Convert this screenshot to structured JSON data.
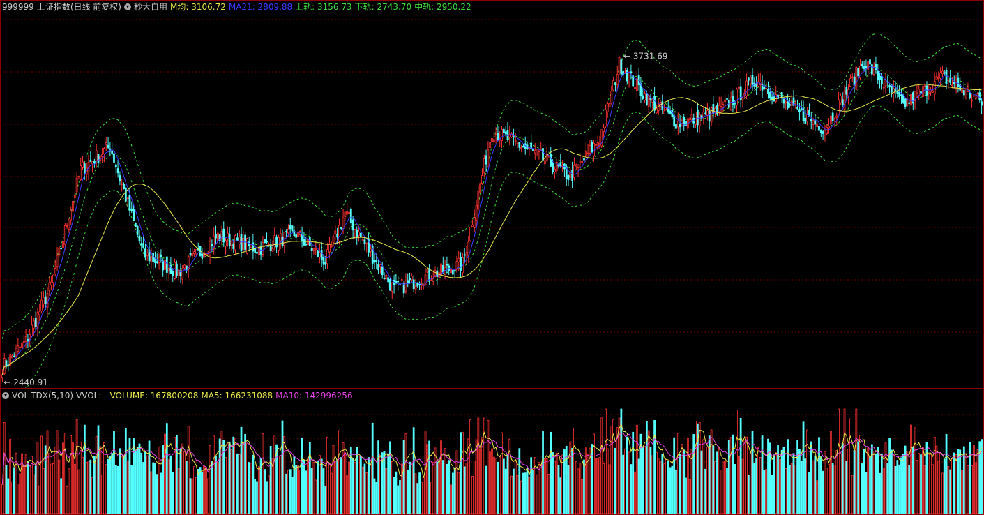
{
  "main_header": {
    "code": "999999",
    "name": "上证指数(日线 前复权)",
    "plugin": "秒大自用",
    "items": [
      {
        "label": "M均:",
        "value": "3106.72",
        "color": "#e8e84a"
      },
      {
        "label": "MA21:",
        "value": "2809.88",
        "color": "#3a3aff"
      },
      {
        "label": "上轨:",
        "value": "3156.73",
        "color": "#3cdc3c"
      },
      {
        "label": "下轨:",
        "value": "2743.70",
        "color": "#3cdc3c"
      },
      {
        "label": "中轨:",
        "value": "2950.22",
        "color": "#3cdc3c"
      }
    ]
  },
  "vol_header": {
    "indicator": "VOL-TDX(5,10)",
    "vvol": "VVOL: -",
    "items": [
      {
        "label": "VOLUME:",
        "value": "167800208",
        "color": "#e8e84a"
      },
      {
        "label": "MA5:",
        "value": "166231088",
        "color": "#e8e84a"
      },
      {
        "label": "MA10:",
        "value": "142996256",
        "color": "#e040e0"
      }
    ]
  },
  "annotations": {
    "high_label": "3731.69",
    "low_label": "2440.91"
  },
  "colors": {
    "up": "#ff3232",
    "down": "#54ffff",
    "mavg": "#e8e84a",
    "ma21": "#3a3aff",
    "band": "#3cdc3c",
    "ma10": "#e040e0",
    "grid": "#6b0000"
  },
  "chart_data": {
    "type": "candlestick",
    "price_range": [
      2440.91,
      3731.69
    ],
    "keypoints": {
      "x_index": [
        0,
        12,
        25,
        40,
        55,
        72,
        90,
        110,
        130,
        150,
        165,
        175,
        185,
        200,
        215,
        235,
        250,
        270,
        290,
        305,
        315,
        330,
        345,
        365,
        385,
        400,
        420,
        440,
        460,
        480,
        500
      ],
      "close": [
        2460,
        2560,
        2780,
        3230,
        3320,
        2900,
        2830,
        2970,
        2920,
        2980,
        2870,
        3060,
        2940,
        2760,
        2810,
        2860,
        3380,
        3300,
        3200,
        3350,
        3640,
        3500,
        3410,
        3450,
        3580,
        3480,
        3390,
        3650,
        3480,
        3590,
        3490
      ]
    },
    "volume_range": [
      0,
      200000000
    ]
  }
}
